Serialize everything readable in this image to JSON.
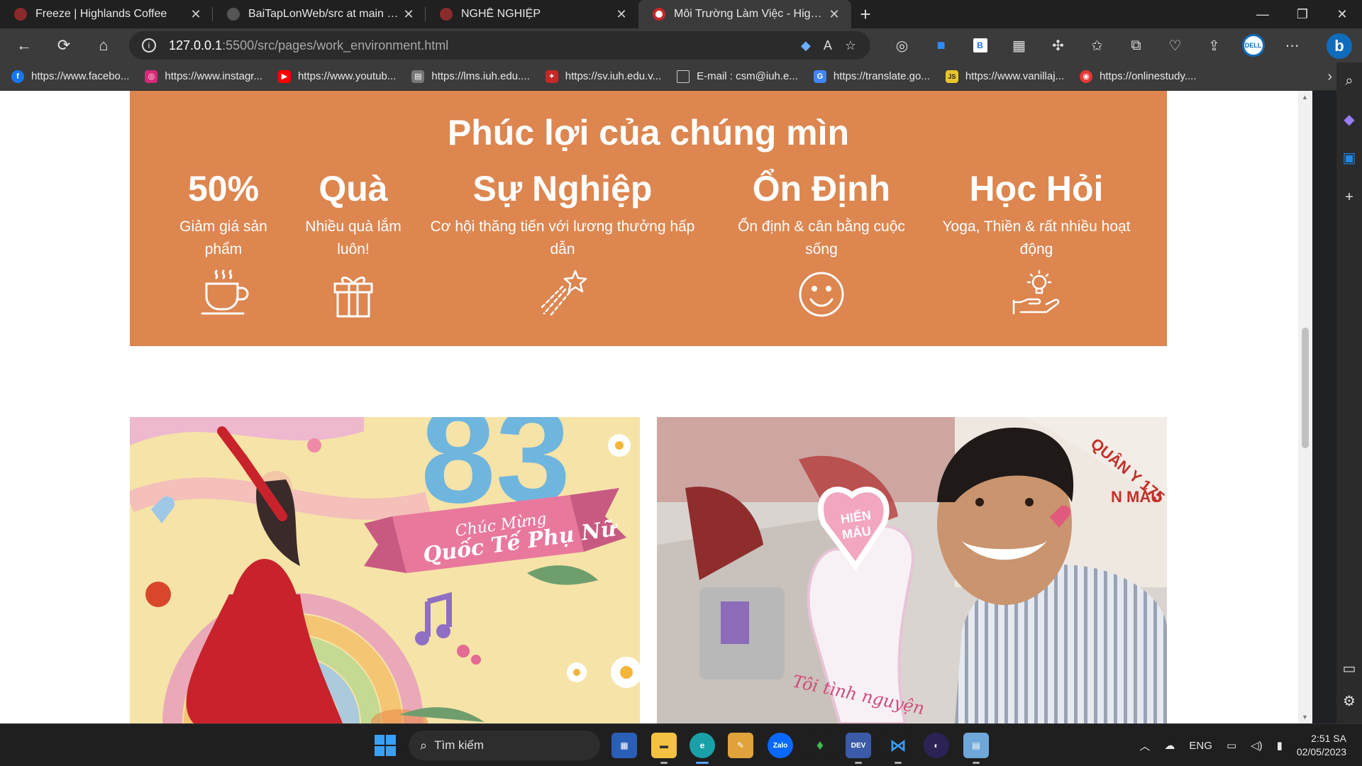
{
  "browser": {
    "tabs": [
      {
        "title": "Freeze | Highlands Coffee",
        "favicon_color": "#b23a3a",
        "active": false
      },
      {
        "title": "BaiTapLonWeb/src at main · Hoan",
        "favicon_color": "#8b8b8b",
        "active": false
      },
      {
        "title": "NGHỀ NGHIỆP",
        "favicon_color": "#b23a3a",
        "active": false
      },
      {
        "title": "Môi Trường Làm Việc - HighLand",
        "favicon_color": "#e04040",
        "active": true
      }
    ],
    "new_tab": "+",
    "window_controls": {
      "minimize": "—",
      "restore": "❐",
      "close": "✕"
    },
    "nav": {
      "back": "←",
      "reload": "⟳",
      "home": "⌂"
    },
    "address": {
      "host": "127.0.0.1",
      "path": ":5500/src/pages/work_environment.html"
    },
    "bookmarks": [
      {
        "label": "https://www.facebo...",
        "color": "#1877f2",
        "glyph": "f"
      },
      {
        "label": "https://www.instagr...",
        "color": "#d62976",
        "glyph": "◎"
      },
      {
        "label": "https://www.youtub...",
        "color": "#ff0000",
        "glyph": "▶"
      },
      {
        "label": "https://lms.iuh.edu....",
        "color": "#777777",
        "glyph": "▤"
      },
      {
        "label": "https://sv.iuh.edu.v...",
        "color": "#c62828",
        "glyph": "✦"
      },
      {
        "label": "E-mail : csm@iuh.e...",
        "color": "#5a5a5a",
        "glyph": "▯"
      },
      {
        "label": "https://translate.go...",
        "color": "#4285f4",
        "glyph": "G"
      },
      {
        "label": "https://www.vanillaj...",
        "color": "#e8c62a",
        "glyph": "JS"
      },
      {
        "label": "https://onlinestudy....",
        "color": "#e53935",
        "glyph": "◉"
      }
    ]
  },
  "page": {
    "benefits": {
      "title": "Phúc lợi của chúng mìn",
      "items": [
        {
          "title": "50%",
          "desc": "Giảm giá sản phẩm",
          "icon": "coffee-cup-icon"
        },
        {
          "title": "Quà",
          "desc": "Nhiều quà lắm luôn!",
          "icon": "gift-icon"
        },
        {
          "title": "Sự Nghiệp",
          "desc": "Cơ hội thăng tiến với lương thưởng hấp dẫn",
          "icon": "shooting-star-icon"
        },
        {
          "title": "Ổn Định",
          "desc": "Ổn định & cân bằng cuộc sống",
          "icon": "smiley-icon"
        },
        {
          "title": "Học Hỏi",
          "desc": "Yoga, Thiền & rất nhiều hoạt động",
          "icon": "idea-hand-icon"
        }
      ]
    },
    "cards": [
      {
        "image": "womens-day-illustration",
        "big_number": "83",
        "banner_line1": "Chúc Mừng",
        "banner_line2": "Quốc Tế Phụ Nữ"
      },
      {
        "image": "blood-donation-photo",
        "sign_line1": "HIẾN",
        "sign_line2": "MÁU",
        "sign_bottom": "Tôi tình nguyện",
        "wall_text1": "QUÂN Y 175",
        "wall_text2": "N MÁU"
      }
    ]
  },
  "taskbar": {
    "search_placeholder": "Tìm kiếm",
    "language": "ENG",
    "time": "2:51 SA",
    "date": "02/05/2023"
  },
  "colors": {
    "benefit_bg": "#dd8650",
    "page_bg": "#ffffff",
    "chrome_dark": "#3b3b3b"
  }
}
